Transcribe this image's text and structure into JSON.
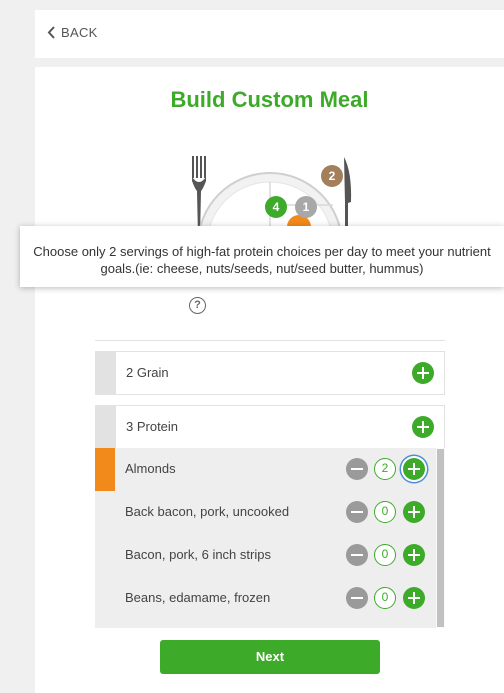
{
  "nav": {
    "back_label": "BACK"
  },
  "page": {
    "title": "Build Custom Meal"
  },
  "plate": {
    "bubbles": [
      {
        "value": "2",
        "color": "#a3805b"
      },
      {
        "value": "4",
        "color": "#3daa2a"
      },
      {
        "value": "1",
        "color": "#a8a8a8"
      }
    ]
  },
  "tooltip": {
    "text": "Choose only 2 servings of high-fat protein choices per day to meet your nutrient goals.(ie: cheese, nuts/seeds, nut/seed butter, hummus)"
  },
  "help_glyph": "?",
  "groups": [
    {
      "label": "2 Grain"
    },
    {
      "label": "3 Protein"
    }
  ],
  "protein_items": [
    {
      "label": "Almonds",
      "count": "2",
      "selected": true
    },
    {
      "label": "Back bacon, pork, uncooked",
      "count": "0",
      "selected": false
    },
    {
      "label": "Bacon, pork, 6 inch strips",
      "count": "0",
      "selected": false
    },
    {
      "label": "Beans, edamame, frozen",
      "count": "0",
      "selected": false
    }
  ],
  "footer": {
    "next_label": "Next"
  },
  "colors": {
    "accent_green": "#3daa2a",
    "selected_orange": "#f28a1b",
    "minus_gray": "#9a9a9a"
  }
}
